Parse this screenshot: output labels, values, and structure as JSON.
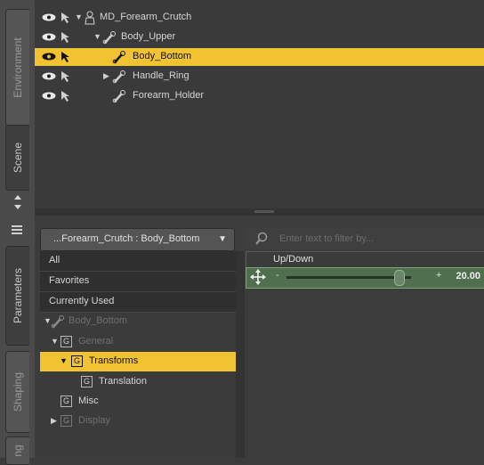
{
  "tabs": {
    "environment": "Environment",
    "scene": "Scene",
    "parameters": "Parameters",
    "shaping": "Shaping",
    "posing": "ng"
  },
  "scene_tree": {
    "items": [
      {
        "label": "MD_Forearm_Crutch",
        "icon": "figure-icon",
        "expanded": true,
        "selected": false
      },
      {
        "label": "Body_Upper",
        "icon": "bone-icon",
        "expanded": true,
        "selected": false
      },
      {
        "label": "Body_Bottom",
        "icon": "bone-icon",
        "selected": true
      },
      {
        "label": "Handle_Ring",
        "icon": "bone-icon",
        "expanded": false,
        "selected": false
      },
      {
        "label": "Forearm_Holder",
        "icon": "bone-icon",
        "selected": false
      }
    ]
  },
  "params": {
    "node_select": "...Forearm_Crutch : Body_Bottom",
    "filter_placeholder": "Enter text to filter by...",
    "tree": {
      "all": "All",
      "favorites": "Favorites",
      "currently_used": "Currently Used",
      "node": "Body_Bottom",
      "general": "General",
      "transforms": "Transforms",
      "translation": "Translation",
      "misc": "Misc",
      "display": "Display"
    },
    "group_glyph": "G",
    "slider": {
      "label": "Up/Down",
      "value": "20.00",
      "minus": "-",
      "plus": "+"
    }
  },
  "colors": {
    "selection": "#f1c231",
    "slider_bg": "#4f6f4f"
  }
}
